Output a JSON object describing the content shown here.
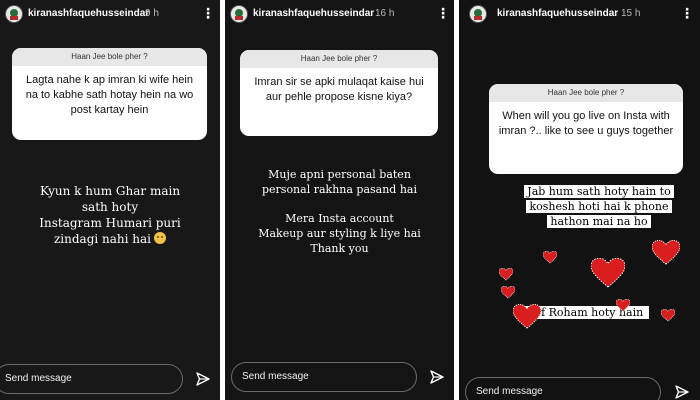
{
  "stories": [
    {
      "username": "kiranashfaquehusseindar",
      "time": "9 h",
      "question_header": "Haan Jee bole pher ?",
      "question": "Lagta nahe k ap imran ki wife hein na to kabhe sath hotay hein na wo post kartay hein",
      "answer_lines": [
        "Kyun k hum Ghar main",
        "sath hoty",
        "Instagram Humari puri",
        "zindagi nahi hai"
      ],
      "emoji": "smiling-face",
      "send_placeholder": "Send message"
    },
    {
      "username": "kiranashfaquehusseindar",
      "time": "16 h",
      "question_header": "Haan Jee bole pher ?",
      "question": "Imran sir se apki mulaqat kaise hui aur pehle propose kisne kiya?",
      "answer_lines": [
        "Muje apni personal baten",
        "personal rakhna pasand hai",
        "",
        "Mera Insta account",
        "Makeup aur styling k liye",
        "hai",
        "Thank you"
      ],
      "send_placeholder": "Send message"
    },
    {
      "username": "kiranashfaquehusseindar",
      "time": "15 h",
      "question_header": "Haan Jee bole pher ?",
      "question": "When will you go live on Insta with imran ?.. like to see u guys together",
      "answer_lines": [
        "Jab hum sath hoty hain to",
        "koshesh hoti hai k phone",
        "hathon mai na ho"
      ],
      "footer_text": "Sirf Roham hoty hain",
      "send_placeholder": "Send message"
    }
  ],
  "icons": {
    "menu": "more-vertical-icon",
    "send": "paper-plane-icon",
    "sticker": "heart-icon",
    "avatar": "profile-avatar"
  },
  "colors": {
    "story_bg": "#161616",
    "question_header_bg": "#e7e7e7",
    "heart_red": "#d81e1e"
  }
}
